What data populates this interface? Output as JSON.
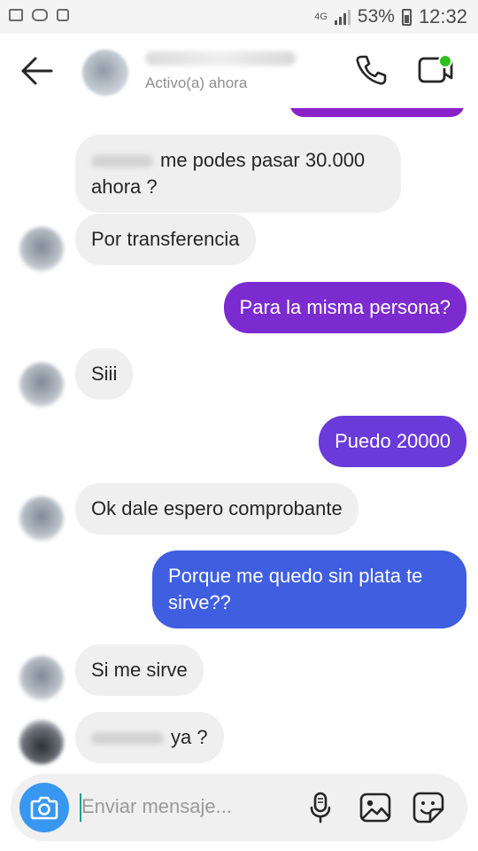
{
  "status_bar": {
    "network": "4G",
    "battery": "53%",
    "time": "12:32"
  },
  "header": {
    "status": "Activo(a) ahora"
  },
  "messages": [
    {
      "id": "m1",
      "text": "me podes pasar 30.000 ahora ?"
    },
    {
      "id": "m2",
      "text": "Por transferencia"
    },
    {
      "id": "m3",
      "text": "Para la misma persona?"
    },
    {
      "id": "m4",
      "text": "Siii"
    },
    {
      "id": "m5",
      "text": "Puedo 20000"
    },
    {
      "id": "m6",
      "text": "Ok dale espero comprobante"
    },
    {
      "id": "m7",
      "text": "Porque me quedo sin plata te sirve??"
    },
    {
      "id": "m8",
      "text": "Si me sirve"
    },
    {
      "id": "m9",
      "text": "ya ?"
    }
  ],
  "composer": {
    "placeholder": "Enviar mensaje..."
  },
  "colors": {
    "outgoing_purple": "#8a22c9",
    "outgoing_violet": "#6a3bd8",
    "outgoing_blue": "#3f5fe0",
    "incoming": "#efefef",
    "online_dot": "#2ec01f",
    "camera_button": "#3897f0"
  },
  "icons": {
    "back": "arrow-left-icon",
    "call": "phone-icon",
    "video": "video-camera-icon",
    "camera": "camera-icon",
    "mic": "microphone-icon",
    "gallery": "image-icon",
    "sticker": "sticker-icon"
  }
}
